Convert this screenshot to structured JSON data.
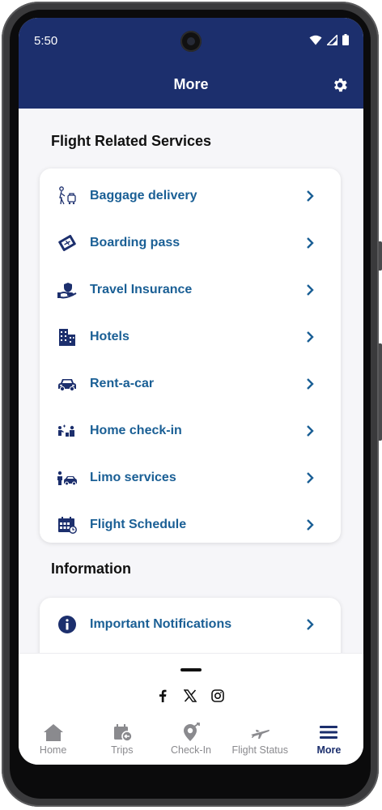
{
  "status_bar": {
    "time": "5:50"
  },
  "header": {
    "title": "More"
  },
  "sections": [
    {
      "title": "Flight Related Services",
      "items": [
        {
          "label": "Baggage delivery",
          "icon": "baggage-icon"
        },
        {
          "label": "Boarding pass",
          "icon": "boarding-pass-icon"
        },
        {
          "label": "Travel Insurance",
          "icon": "insurance-icon"
        },
        {
          "label": "Hotels",
          "icon": "hotel-icon"
        },
        {
          "label": "Rent-a-car",
          "icon": "car-icon"
        },
        {
          "label": "Home check-in",
          "icon": "home-checkin-icon"
        },
        {
          "label": "Limo services",
          "icon": "limo-icon"
        },
        {
          "label": "Flight Schedule",
          "icon": "calendar-icon"
        }
      ]
    },
    {
      "title": "Information",
      "items": [
        {
          "label": "Important Notifications",
          "icon": "info-icon"
        }
      ]
    }
  ],
  "bottom_nav": {
    "tabs": [
      {
        "label": "Home",
        "icon": "home-icon"
      },
      {
        "label": "Trips",
        "icon": "trips-icon"
      },
      {
        "label": "Check-In",
        "icon": "checkin-icon"
      },
      {
        "label": "Flight Status",
        "icon": "plane-icon"
      },
      {
        "label": "More",
        "icon": "menu-icon"
      }
    ],
    "active": "More"
  },
  "colors": {
    "header_bg": "#1c2f6d",
    "link": "#1a5f95",
    "icon_navy": "#1c2f6d",
    "tab_inactive": "#8a8a8e"
  }
}
